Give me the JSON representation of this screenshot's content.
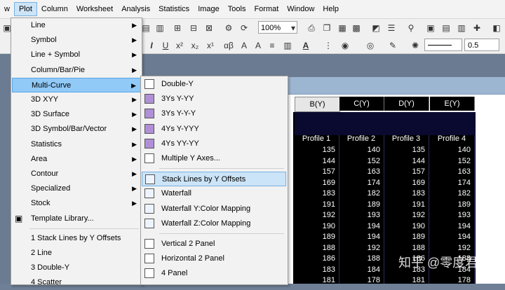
{
  "menubar": {
    "items": [
      "w",
      "Plot",
      "Column",
      "Worksheet",
      "Analysis",
      "Statistics",
      "Image",
      "Tools",
      "Format",
      "Window",
      "Help"
    ],
    "active": "Plot"
  },
  "toolbar": {
    "zoom": "100%",
    "line_width": "0.5"
  },
  "plot_menu": {
    "items": [
      {
        "label": "Line",
        "submenu": true
      },
      {
        "label": "Symbol",
        "submenu": true
      },
      {
        "label": "Line + Symbol",
        "submenu": true
      },
      {
        "label": "Column/Bar/Pie",
        "submenu": true
      },
      {
        "label": "Multi-Curve",
        "submenu": true,
        "highlighted": true
      },
      {
        "label": "3D XYY",
        "submenu": true
      },
      {
        "label": "3D Surface",
        "submenu": true
      },
      {
        "label": "3D Symbol/Bar/Vector",
        "submenu": true
      },
      {
        "label": "Statistics",
        "submenu": true
      },
      {
        "label": "Area",
        "submenu": true
      },
      {
        "label": "Contour",
        "submenu": true
      },
      {
        "label": "Specialized",
        "submenu": true
      },
      {
        "label": "Stock",
        "submenu": true
      },
      {
        "label": "Template Library...",
        "submenu": false
      }
    ],
    "recent": [
      "1 Stack Lines by Y Offsets",
      "2 Line",
      "3 Double-Y",
      "4 Scatter"
    ]
  },
  "multicurve_menu": {
    "items": [
      {
        "label": "Double-Y",
        "icon": "double-y-icon"
      },
      {
        "label": "3Ys Y-YY",
        "icon": "three-ys-icon"
      },
      {
        "label": "3Ys Y-Y-Y",
        "icon": "three-ys-icon"
      },
      {
        "label": "4Ys Y-YYY",
        "icon": "four-ys-icon"
      },
      {
        "label": "4Ys YY-YY",
        "icon": "four-ys-icon"
      },
      {
        "label": "Multiple Y Axes...",
        "icon": "multiple-y-icon"
      },
      {
        "label": "Stack Lines by Y Offsets",
        "icon": "stack-lines-icon",
        "highlighted": true
      },
      {
        "label": "Waterfall",
        "icon": "waterfall-icon"
      },
      {
        "label": "Waterfall Y:Color Mapping",
        "icon": "waterfall-icon"
      },
      {
        "label": "Waterfall Z:Color Mapping",
        "icon": "waterfall-icon"
      },
      {
        "label": "Vertical 2 Panel",
        "icon": "vertical-panel-icon"
      },
      {
        "label": "Horizontal 2 Panel",
        "icon": "horizontal-panel-icon"
      },
      {
        "label": "4 Panel",
        "icon": "four-panel-icon"
      }
    ]
  },
  "sheet": {
    "columns": [
      "B(Y)",
      "C(Y)",
      "D(Y)",
      "E(Y)"
    ],
    "selected_column": "B(Y)",
    "long_names": [
      "Profile 1",
      "Profile 2",
      "Profile 3",
      "Profile 4"
    ],
    "rows": [
      [
        135,
        140,
        135,
        140
      ],
      [
        144,
        152,
        144,
        152
      ],
      [
        157,
        163,
        157,
        163
      ],
      [
        169,
        174,
        169,
        174
      ],
      [
        183,
        182,
        183,
        182
      ],
      [
        191,
        189,
        191,
        189
      ],
      [
        192,
        193,
        192,
        193
      ],
      [
        190,
        194,
        190,
        194
      ],
      [
        189,
        194,
        189,
        194
      ],
      [
        188,
        192,
        188,
        192
      ],
      [
        186,
        188,
        186,
        188
      ],
      [
        183,
        184,
        183,
        184
      ],
      [
        181,
        178,
        181,
        178
      ]
    ]
  },
  "watermark": "知乎 @零度君",
  "colors": {
    "menu_highlight": "#91c9f7",
    "sheet_bg": "#000000",
    "workspace": "#6b7b91"
  }
}
